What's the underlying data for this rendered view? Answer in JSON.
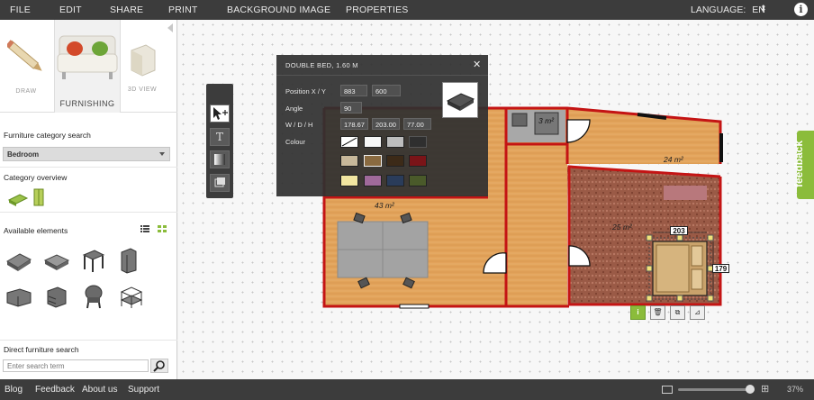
{
  "menu": {
    "items": [
      "FILE",
      "EDIT",
      "SHARE",
      "PRINT",
      "BACKGROUND IMAGE",
      "PROPERTIES"
    ],
    "language_label": "LANGUAGE:",
    "language_value": "EN"
  },
  "sidebar": {
    "modes": {
      "draw": "DRAW",
      "furnishing": "FURNISHING",
      "view3d": "3D VIEW"
    },
    "category_search_label": "Furniture category search",
    "category_selected": "Bedroom",
    "category_overview_label": "Category overview",
    "available_elements_label": "Available elements",
    "direct_search_label": "Direct furniture search",
    "search_placeholder": "Enter search term"
  },
  "panel": {
    "title": "DOUBLE BED, 1.60 M",
    "position_label": "Position X / Y",
    "position_x": "883",
    "position_y": "600",
    "angle_label": "Angle",
    "angle_value": "90",
    "wdh_label": "W / D / H",
    "width": "178.67",
    "depth": "203.00",
    "height": "77.00",
    "colour_label": "Colour",
    "swatches": [
      "none",
      "#f6f6f6",
      "#bdbdbd",
      "#2f2f2f",
      "#c8b89a",
      "#8a6a40",
      "#3c2a18",
      "#7a1418",
      "#f2e6a0",
      "#a06a9a",
      "#2a3c5a",
      "#4a5a2a"
    ]
  },
  "floorplan": {
    "areas": [
      "43 m²",
      "3 m²",
      "24 m²",
      "25 m²"
    ],
    "bed_width_dim": "203",
    "bed_depth_dim": "179"
  },
  "feedback_label": "feedback",
  "footer": {
    "links": [
      "Blog",
      "Feedback",
      "About us",
      "Support"
    ],
    "zoom": "37%"
  }
}
